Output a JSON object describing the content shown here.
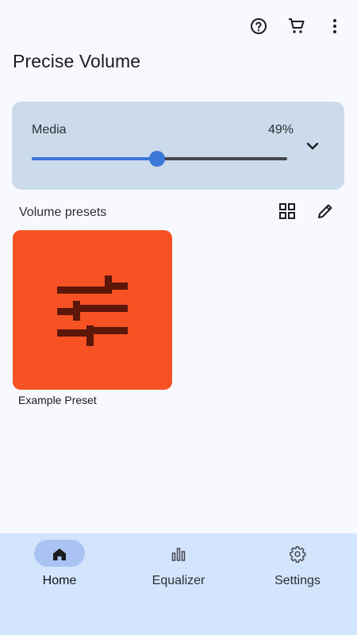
{
  "app": {
    "title": "Precise Volume"
  },
  "toolbar": {
    "help_icon": "help-circle-icon",
    "cart_icon": "shopping-cart-icon",
    "more_icon": "more-vert-icon"
  },
  "volume": {
    "label": "Media",
    "percent_text": "49%",
    "level": 0.49
  },
  "presets": {
    "header": "Volume presets",
    "items": [
      {
        "name": "Example Preset",
        "color": "#f65223",
        "icon": "tune-sliders-icon"
      }
    ]
  },
  "nav": {
    "items": [
      {
        "label": "Home",
        "icon": "home-icon",
        "active": true
      },
      {
        "label": "Equalizer",
        "icon": "equalizer-icon",
        "active": false
      },
      {
        "label": "Settings",
        "icon": "gear-icon",
        "active": false
      }
    ]
  },
  "colors": {
    "accent": "#3c78d8",
    "card": "#cbdbeb",
    "nav_background": "#d3e4fd",
    "nav_active_pill": "#a9c4f2"
  }
}
